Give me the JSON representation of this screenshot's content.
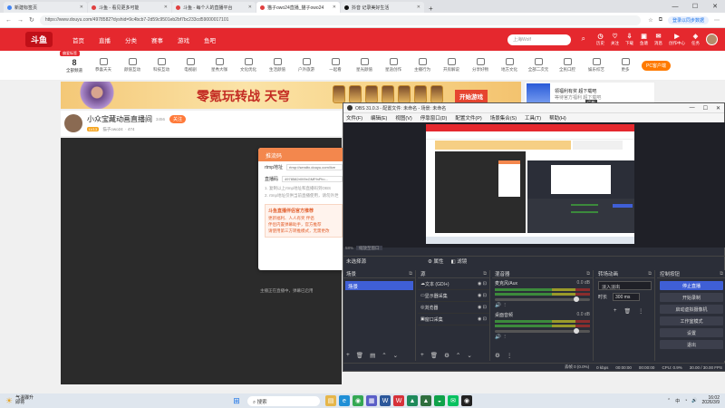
{
  "browser": {
    "tabs": [
      {
        "label": "新建标签页",
        "color": "#4285f4"
      },
      {
        "label": "斗鱼 - 看见更多可能",
        "color": "#e04040"
      },
      {
        "label": "斗鱼 - 每个人的直播平台",
        "color": "#e04040"
      },
      {
        "label": "猫子owo24直播_猫子owo24",
        "color": "#e04040"
      },
      {
        "label": "抖音 记录美好生活",
        "color": "#111111"
      }
    ],
    "url": "https://www.douyu.com/4978582?dyshid=9c4bcb7-2d59c9501eb2bf7bc233cd59000017101",
    "login_label": "登录以同步数据"
  },
  "douyu": {
    "logo": "斗鱼",
    "nav": [
      "首页",
      "直播",
      "分类",
      "赛事",
      "游戏",
      "鱼吧"
    ],
    "search_placeholder": "上海Wolf",
    "right_icons": [
      {
        "icon": "◷",
        "label": "历史"
      },
      {
        "icon": "♡",
        "label": "关注"
      },
      {
        "icon": "⇩",
        "label": "下载"
      },
      {
        "icon": "▣",
        "label": "鱼塘"
      },
      {
        "icon": "✉",
        "label": "消息"
      },
      {
        "icon": "▶",
        "label": "创作中心"
      },
      {
        "icon": "◈",
        "label": "任务"
      }
    ],
    "category_badge": "偏爱标签",
    "categories": [
      {
        "big": "8",
        "label": "全部频道"
      },
      {
        "label": "恭喜天天"
      },
      {
        "label": "颜值互动"
      },
      {
        "label": "科技互动"
      },
      {
        "label": "电视剧"
      },
      {
        "label": "星秀大咖"
      },
      {
        "label": "文化优化"
      },
      {
        "label": "生活颜值"
      },
      {
        "label": "户外旅游"
      },
      {
        "label": "一起看"
      },
      {
        "label": "星光颜值"
      },
      {
        "label": "星途创作"
      },
      {
        "label": "主播行为"
      },
      {
        "label": "开房解说"
      },
      {
        "label": "分享好物"
      },
      {
        "label": "地方文化"
      },
      {
        "label": "全部二次元"
      },
      {
        "label": "全民口腔"
      },
      {
        "label": "娱乐综艺"
      },
      {
        "label": "更多"
      }
    ],
    "pc_client": "PC客户端",
    "banner": {
      "title": "零氪玩转战 天穹",
      "play": "开始游戏"
    },
    "ad": {
      "line1": "领福利有奖 超下载吧",
      "line2": "等待官方福利 超下载吧",
      "tag": "广告"
    },
    "channel": {
      "name": "小众宝藏动画直播间",
      "level": "LV13",
      "host": "猫子owo24",
      "follow": "关注",
      "fans": "474",
      "hot": "3456"
    },
    "player_tip": "主播正在直播中，弹幕已启用",
    "stream_dialog": {
      "title": "推流码",
      "rtmp_label": "rtmp地址",
      "rtmp_value": "rtmp://sendtx.douyu.com/live",
      "key_label": "直播码",
      "key_value": "4978582rlXl9xGMFfnPb=...",
      "note1": "1. 复制以上rtmp地址和直播码到OBS",
      "note2": "2. rtmp地址仅供当前直播使用，请勿外泄",
      "promo_title": "斗鱼直播伴侣官方推荐",
      "promo1": "更新福利、人人有奖 伴侣",
      "promo2": "伴侣内置弹幕助手，官方推荐",
      "promo3": "请使用第三方转推模式，无需更改"
    }
  },
  "obs": {
    "title": "OBS 31.0.3 - 配置文件: 未命名 - 场景: 未命名",
    "menu": [
      "文件(F)",
      "编辑(E)",
      "视图(V)",
      "停靠窗口(D)",
      "配置文件(P)",
      "场景集合(S)",
      "工具(T)",
      "帮助(H)"
    ],
    "zoom": "58%",
    "zoom_mode": "缩放至窗口",
    "no_source": "未选择源",
    "properties": "属性",
    "filters": "滤镜",
    "scenes_title": "场景",
    "scene_selected": "场景",
    "sources_title": "源",
    "sources": [
      "文本 (GDI+)",
      "显示器采集",
      "浏览器",
      "窗口采集"
    ],
    "mixer_title": "混音器",
    "mixer_channels": [
      {
        "name": "桌面音频",
        "db": "0.0 dB"
      },
      {
        "name": "麦克风/Aux",
        "db": "0.0 dB"
      }
    ],
    "transitions_title": "转场动画",
    "transition": "淡入淡出",
    "duration_label": "时长",
    "duration": "300 ms",
    "controls_title": "控制按钮",
    "controls": [
      "停止直播",
      "开始录制",
      "启动虚拟摄像机",
      "工作室模式",
      "设置",
      "退出"
    ],
    "status": {
      "dropped": "丢帧 0 (0.0%)",
      "kbps": "0 kbps",
      "live": "00:00:00",
      "rec": "00:00:00",
      "cpu": "CPU: 0.9%",
      "fps": "30.00 / 30.00 FPS"
    }
  },
  "taskbar": {
    "weather_top": "气温骤升",
    "weather_bottom": "即将",
    "search": "搜索",
    "apps": [
      {
        "name": "files",
        "color": "#e6b64a",
        "glyph": "▤"
      },
      {
        "name": "edge",
        "color": "#1f8fd6",
        "glyph": "e"
      },
      {
        "name": "chrome",
        "color": "#34a853",
        "glyph": "◉"
      },
      {
        "name": "store",
        "color": "#5b5fc7",
        "glyph": "▦"
      },
      {
        "name": "word",
        "color": "#2b579a",
        "glyph": "W"
      },
      {
        "name": "wps",
        "color": "#d6323a",
        "glyph": "W"
      },
      {
        "name": "app7",
        "color": "#1e8a5b",
        "glyph": "▲"
      },
      {
        "name": "app8",
        "color": "#2f6f3e",
        "glyph": "▲"
      },
      {
        "name": "app9",
        "color": "#0fa24a",
        "glyph": "◒"
      },
      {
        "name": "wechat",
        "color": "#07c160",
        "glyph": "✉"
      },
      {
        "name": "obs",
        "color": "#222222",
        "glyph": "◉"
      }
    ],
    "lang": "中",
    "time": "16:02",
    "date": "2026/3/9"
  }
}
